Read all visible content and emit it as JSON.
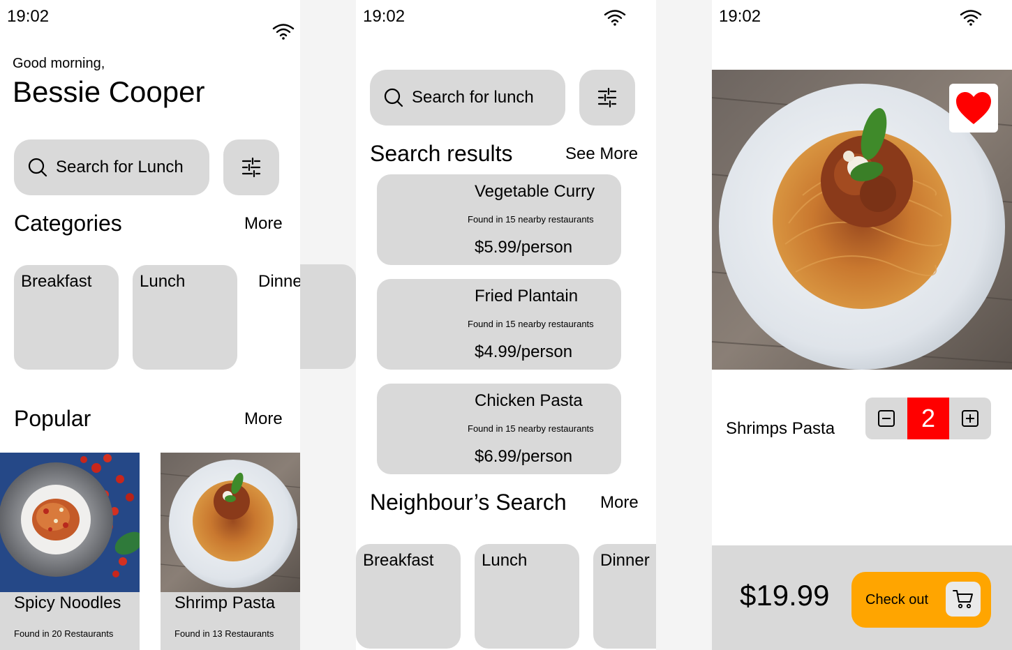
{
  "home": {
    "time": "19:02",
    "greeting": "Good morning,",
    "user_name": "Bessie Cooper",
    "search_placeholder": "Search for Lunch",
    "categories_title": "Categories",
    "categories_more": "More",
    "categories": [
      "Breakfast",
      "Lunch",
      "Dinner"
    ],
    "popular_title": "Popular",
    "popular_more": "More",
    "popular": [
      {
        "name": "Spicy Noodles",
        "sub": "Found in 20 Restaurants"
      },
      {
        "name": "Shrimp Pasta",
        "sub": "Found in 13 Restaurants"
      }
    ]
  },
  "search": {
    "time": "19:02",
    "search_placeholder": "Search for lunch",
    "results_title": "Search results",
    "results_more": "See More",
    "results": [
      {
        "name": "Vegetable Curry",
        "sub": "Found in 15 nearby restaurants",
        "price": "$5.99/person"
      },
      {
        "name": "Fried Plantain",
        "sub": "Found in 15 nearby restaurants",
        "price": "$4.99/person"
      },
      {
        "name": "Chicken Pasta",
        "sub": "Found in 15 nearby restaurants",
        "price": "$6.99/person"
      }
    ],
    "neighbour_title": "Neighbour’s Search",
    "neighbour_more": "More",
    "neighbour": [
      "Breakfast",
      "Lunch",
      "Dinner"
    ]
  },
  "detail": {
    "time": "19:02",
    "dish_name": "Shrimps Pasta",
    "quantity": "2",
    "total": "$19.99",
    "checkout_label": "Check out",
    "accent_color": "#ffa500",
    "quantity_color": "#ff0000",
    "heart_color": "#ff0000"
  }
}
